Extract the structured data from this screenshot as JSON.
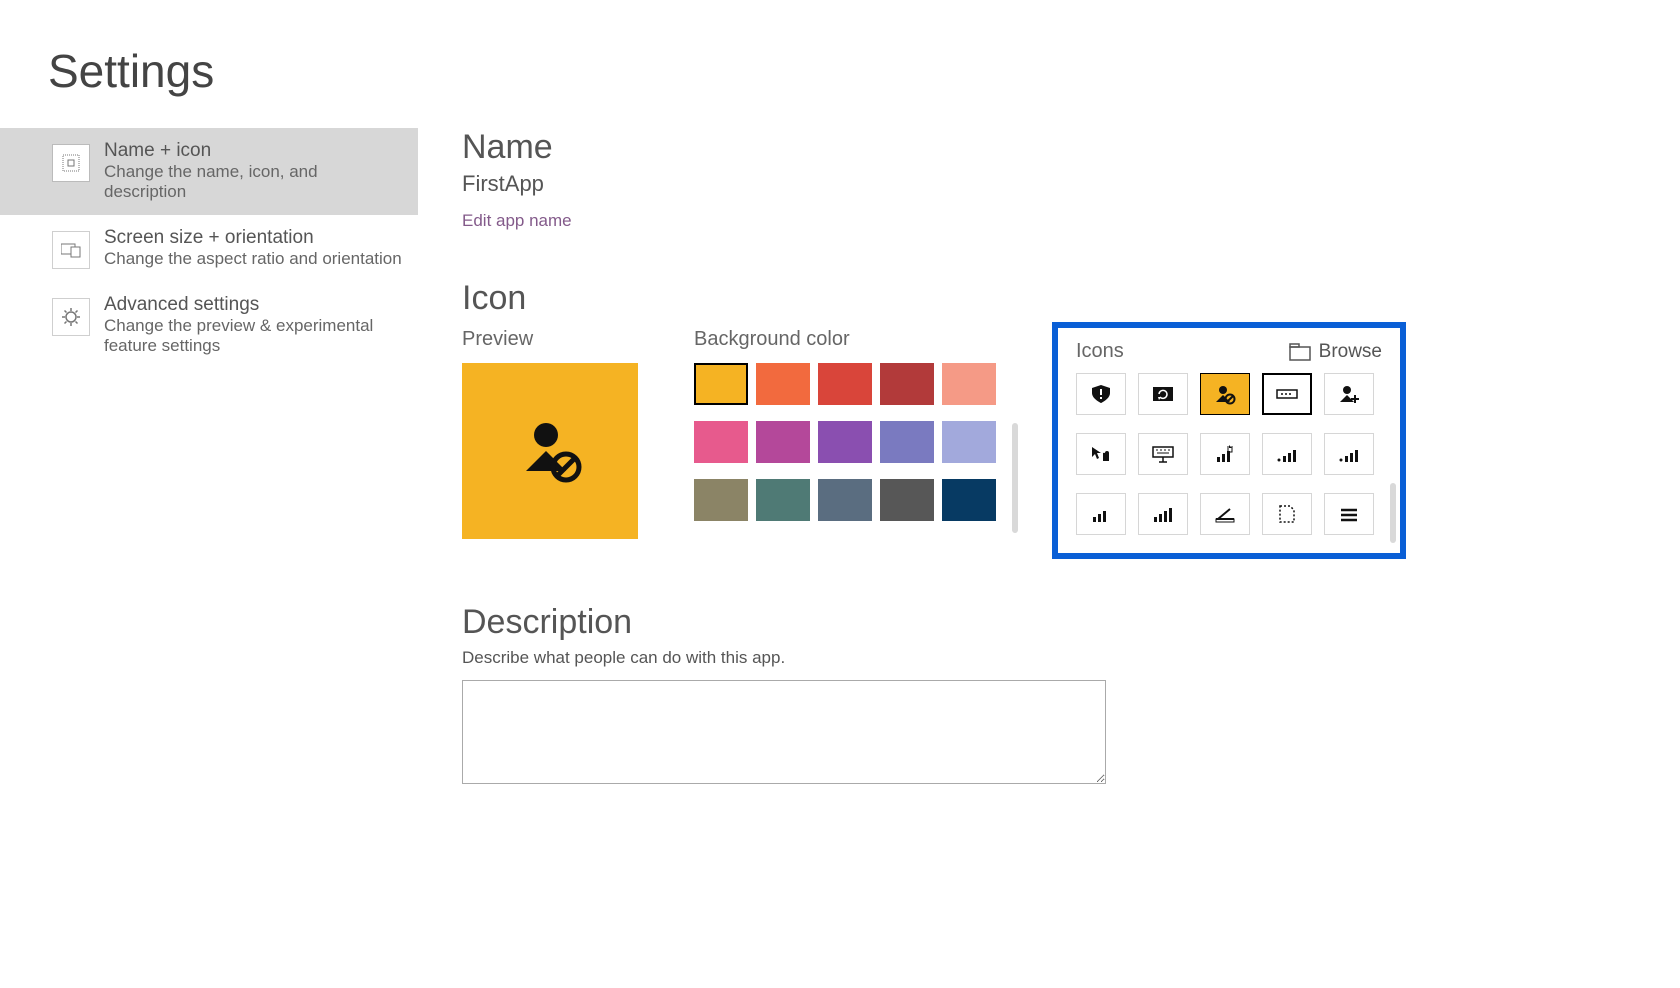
{
  "page_title": "Settings",
  "sidebar": {
    "items": [
      {
        "title": "Name + icon",
        "subtitle": "Change the name, icon, and description",
        "icon": "grid-icon",
        "selected": true
      },
      {
        "title": "Screen size + orientation",
        "subtitle": "Change the aspect ratio and orientation",
        "icon": "devices-icon",
        "selected": false
      },
      {
        "title": "Advanced settings",
        "subtitle": "Change the preview & experimental feature settings",
        "icon": "gear-icon",
        "selected": false
      }
    ]
  },
  "name_section": {
    "heading": "Name",
    "app_name": "FirstApp",
    "edit_link": "Edit app name"
  },
  "icon_section": {
    "heading": "Icon",
    "preview_label": "Preview",
    "preview_bg": "#f5b323",
    "preview_icon": "user-block-icon",
    "bg_color_label": "Background color",
    "colors": [
      {
        "hex": "#f5b323",
        "selected": true
      },
      {
        "hex": "#f26a3e"
      },
      {
        "hex": "#d9453a"
      },
      {
        "hex": "#b23a3a"
      },
      {
        "hex": "#f59a86"
      },
      {
        "hex": "#e75a8d"
      },
      {
        "hex": "#b4489a"
      },
      {
        "hex": "#8a4fb0"
      },
      {
        "hex": "#7a7ac0"
      },
      {
        "hex": "#a2a9dc"
      },
      {
        "hex": "#8b8466"
      },
      {
        "hex": "#4f7a75"
      },
      {
        "hex": "#5a6d80"
      },
      {
        "hex": "#575757"
      },
      {
        "hex": "#073a63"
      }
    ],
    "icons_panel": {
      "label": "Icons",
      "browse_label": "Browse",
      "icons": [
        {
          "name": "shield-alert-icon"
        },
        {
          "name": "image-refresh-icon"
        },
        {
          "name": "user-block-icon",
          "selected": true
        },
        {
          "name": "text-field-icon",
          "focus2": true
        },
        {
          "name": "user-add-icon"
        },
        {
          "name": "pointer-hand-icon"
        },
        {
          "name": "keyboard-network-icon"
        },
        {
          "name": "bars-click-icon"
        },
        {
          "name": "bars-dot-icon"
        },
        {
          "name": "bars-dot-alt-icon"
        },
        {
          "name": "bars-small-icon"
        },
        {
          "name": "bars-full-icon"
        },
        {
          "name": "scanner-icon"
        },
        {
          "name": "dashed-doc-icon"
        },
        {
          "name": "menu-lines-icon"
        }
      ]
    }
  },
  "description_section": {
    "heading": "Description",
    "prompt": "Describe what people can do with this app.",
    "value": ""
  }
}
